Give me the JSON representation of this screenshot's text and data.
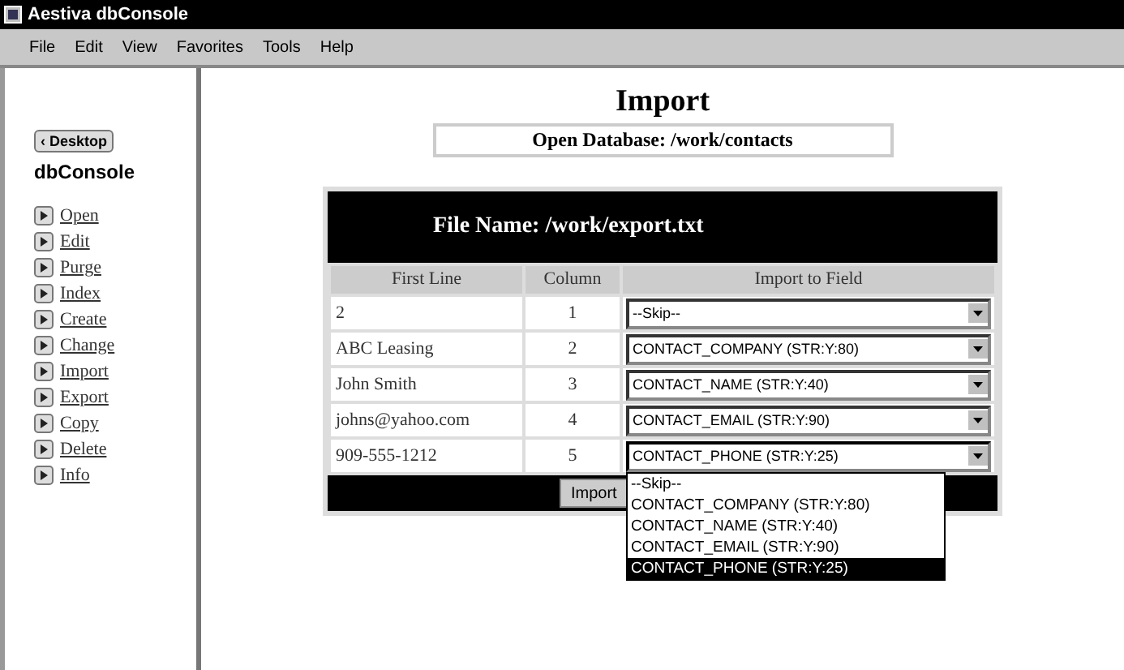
{
  "window": {
    "title": "Aestiva dbConsole"
  },
  "menu": [
    "File",
    "Edit",
    "View",
    "Favorites",
    "Tools",
    "Help"
  ],
  "sidebar": {
    "back_button": "‹ Desktop",
    "logo": "dbConsole",
    "items": [
      {
        "label": "Open"
      },
      {
        "label": "Edit"
      },
      {
        "label": "Purge"
      },
      {
        "label": "Index"
      },
      {
        "label": "Create"
      },
      {
        "label": "Change"
      },
      {
        "label": "Import"
      },
      {
        "label": "Export"
      },
      {
        "label": "Copy"
      },
      {
        "label": "Delete"
      },
      {
        "label": "Info"
      }
    ]
  },
  "page": {
    "title": "Import",
    "open_database": "Open Database:  /work/contacts",
    "file_name": "File Name: /work/export.txt"
  },
  "table": {
    "columns": [
      "First Line",
      "Column",
      "Import to Field"
    ],
    "rows": [
      {
        "first_line": "2",
        "column": "1",
        "field": "--Skip--",
        "expanded": false
      },
      {
        "first_line": "ABC Leasing",
        "column": "2",
        "field": "CONTACT_COMPANY (STR:Y:80)",
        "expanded": false
      },
      {
        "first_line": "John Smith",
        "column": "3",
        "field": "CONTACT_NAME (STR:Y:40)",
        "expanded": false
      },
      {
        "first_line": "johns@yahoo.com",
        "column": "4",
        "field": "CONTACT_EMAIL (STR:Y:90)",
        "expanded": false
      },
      {
        "first_line": "909-555-1212",
        "column": "5",
        "field": "CONTACT_PHONE (STR:Y:25)",
        "expanded": true
      }
    ]
  },
  "dropdown_options": [
    {
      "label": "--Skip--",
      "selected": false
    },
    {
      "label": "CONTACT_COMPANY (STR:Y:80)",
      "selected": false
    },
    {
      "label": "CONTACT_NAME (STR:Y:40)",
      "selected": false
    },
    {
      "label": "CONTACT_EMAIL (STR:Y:90)",
      "selected": false
    },
    {
      "label": "CONTACT_PHONE (STR:Y:25)",
      "selected": true
    }
  ],
  "import_button": "Import"
}
